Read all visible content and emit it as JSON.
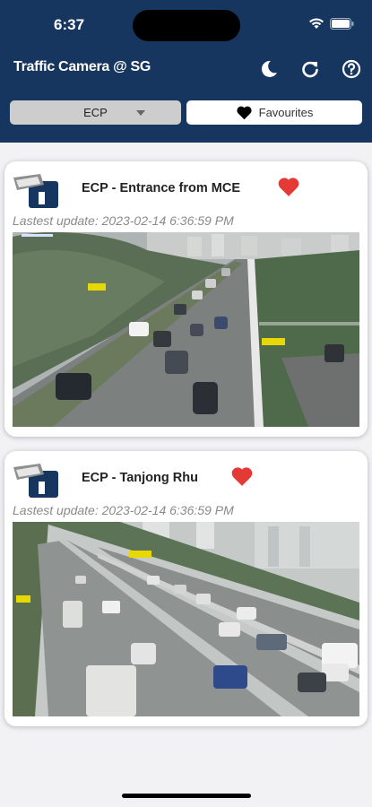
{
  "status": {
    "time": "6:37"
  },
  "header": {
    "title": "Traffic Camera @ SG"
  },
  "filter": {
    "selected": "ECP",
    "favourites_label": "Favourites"
  },
  "colors": {
    "header_bg": "#17365f",
    "heart": "#e53935"
  },
  "cameras": [
    {
      "title": "ECP - Entrance from MCE",
      "update": "Lastest update: 2023-02-14 6:36:59 PM",
      "favourited": true,
      "overlay_labels": [
        "CITY",
        "CHANGI"
      ]
    },
    {
      "title": "ECP - Tanjong Rhu",
      "update": "Lastest update: 2023-02-14 6:36:59 PM",
      "favourited": true,
      "overlay_labels": [
        "CHANGI",
        "CHANGI",
        "CITY"
      ]
    }
  ]
}
